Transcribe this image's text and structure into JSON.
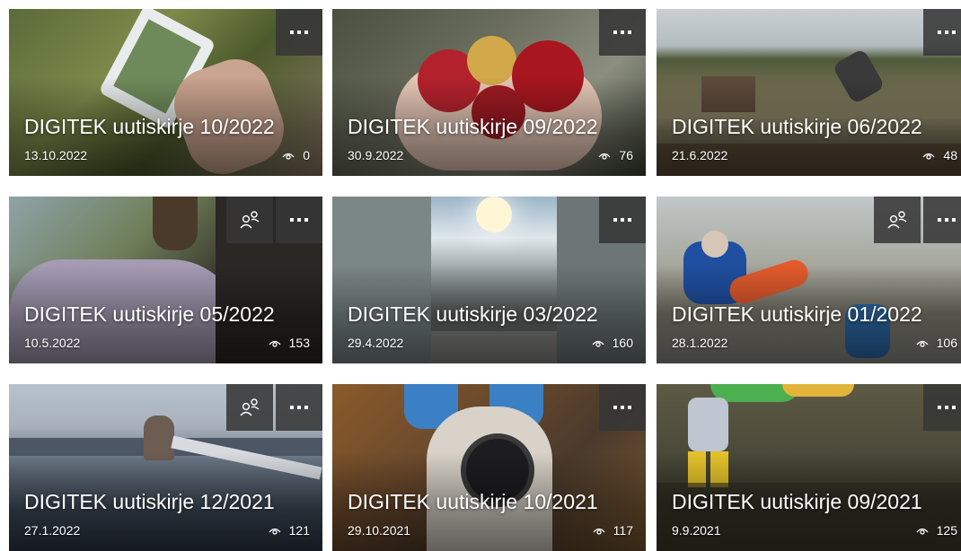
{
  "colors": {
    "overlay_button": "#373737",
    "text": "#ffffff"
  },
  "icons": {
    "views": "eye-icon",
    "more": "more-options-icon",
    "shared": "people-icon"
  },
  "cards": [
    {
      "title": "DIGITEK uutiskirje 10/2022",
      "date": "13.10.2022",
      "views": "0",
      "shared": false
    },
    {
      "title": "DIGITEK uutiskirje 09/2022",
      "date": "30.9.2022",
      "views": "76",
      "shared": false
    },
    {
      "title": "DIGITEK uutiskirje 06/2022",
      "date": "21.6.2022",
      "views": "48",
      "shared": false
    },
    {
      "title": "DIGITEK uutiskirje 05/2022",
      "date": "10.5.2022",
      "views": "153",
      "shared": true
    },
    {
      "title": "DIGITEK uutiskirje 03/2022",
      "date": "29.4.2022",
      "views": "160",
      "shared": false
    },
    {
      "title": "DIGITEK uutiskirje 01/2022",
      "date": "28.1.2022",
      "views": "106",
      "shared": true
    },
    {
      "title": "DIGITEK uutiskirje 12/2021",
      "date": "27.1.2022",
      "views": "121",
      "shared": true
    },
    {
      "title": "DIGITEK uutiskirje 10/2021",
      "date": "29.10.2021",
      "views": "117",
      "shared": false
    },
    {
      "title": "DIGITEK uutiskirje 09/2021",
      "date": "9.9.2021",
      "views": "125",
      "shared": false
    }
  ]
}
